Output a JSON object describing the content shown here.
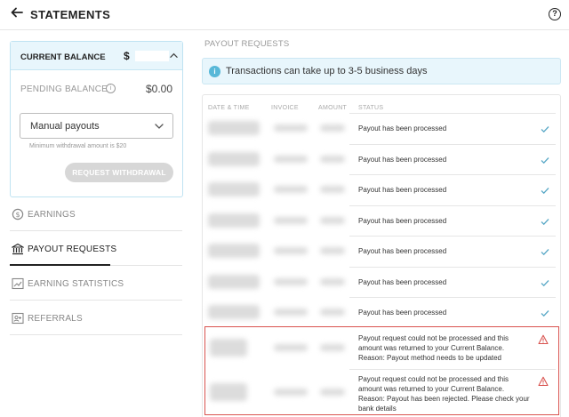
{
  "header": {
    "title": "STATEMENTS",
    "back_icon": "arrow-left-icon",
    "help_icon": "question-shield-icon"
  },
  "balance": {
    "current_label": "CURRENT BALANCE",
    "currency_symbol": "$",
    "pending_label": "PENDING BALANCE",
    "pending_value": "$0.00",
    "payout_method": "Manual payouts",
    "min_note": "Minimum withdrawal amount is $20",
    "withdraw_button": "REQUEST WITHDRAWAL"
  },
  "nav": {
    "earnings": "EARNINGS",
    "payout_requests": "PAYOUT REQUESTS",
    "earning_statistics": "EARNING STATISTICS",
    "referrals": "REFERRALS"
  },
  "main": {
    "section_title": "PAYOUT REQUESTS",
    "notice": "Transactions can take up to 3-5 business days",
    "columns": {
      "date_time": "DATE & TIME",
      "invoice": "INVOICE",
      "amount": "AMOUNT",
      "status": "STATUS"
    },
    "rows": [
      {
        "status": "Payout has been processed",
        "state": "success"
      },
      {
        "status": "Payout has been processed",
        "state": "success"
      },
      {
        "status": "Payout has been processed",
        "state": "success"
      },
      {
        "status": "Payout has been processed",
        "state": "success"
      },
      {
        "status": "Payout has been processed",
        "state": "success"
      },
      {
        "status": "Payout has been processed",
        "state": "success"
      },
      {
        "status": "Payout has been processed",
        "state": "success"
      },
      {
        "status_lines": [
          "Payout request could not be processed and this",
          "amount was returned to your Current Balance.",
          "Reason: Payout method needs to be updated"
        ],
        "state": "error"
      },
      {
        "status_lines": [
          "Payout request could not be processed and this",
          "amount was returned to your Current Balance.",
          "Reason: Payout has been rejected. Please check your",
          "bank details"
        ],
        "state": "error"
      }
    ]
  },
  "colors": {
    "accent_light": "#e8f6fc",
    "info_icon": "#58b8d8",
    "success_check": "#5aa9c7",
    "error": "#d9534f"
  }
}
